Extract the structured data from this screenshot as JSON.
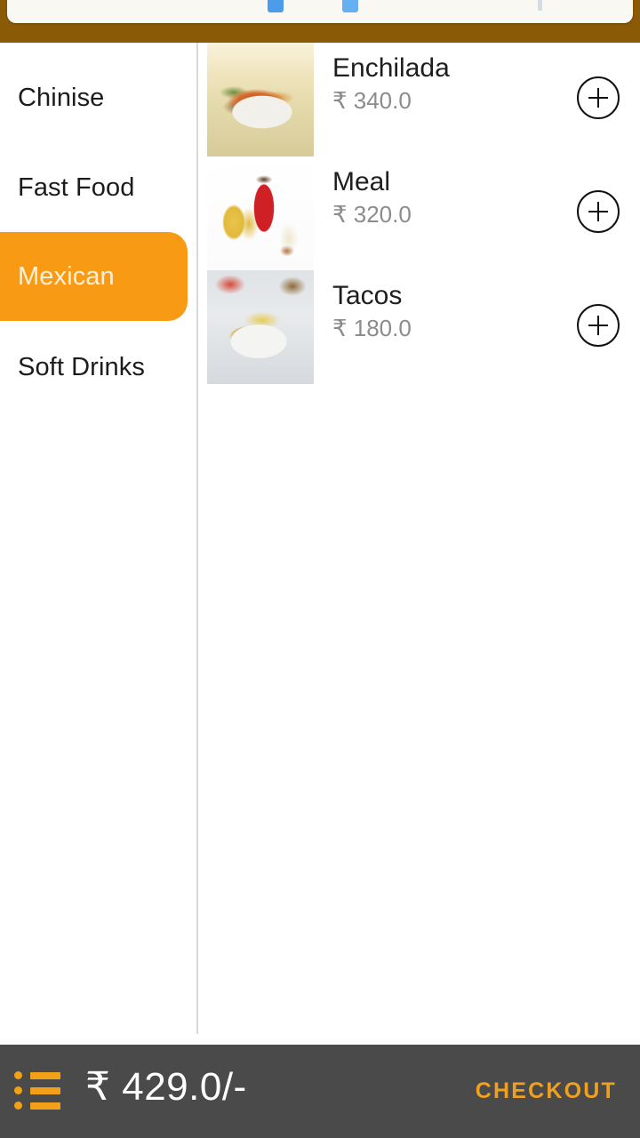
{
  "top_overlay": {
    "icons": [
      "blue-square-icon",
      "blue-square-icon",
      "scrollbar-handle-icon"
    ]
  },
  "sidebar": {
    "items": [
      {
        "label": "Chinise",
        "selected": false
      },
      {
        "label": "Fast Food",
        "selected": false
      },
      {
        "label": "Mexican",
        "selected": true
      },
      {
        "label": "Soft Drinks",
        "selected": false
      }
    ]
  },
  "food_list": {
    "items": [
      {
        "name": "Enchilada",
        "price": "₹ 340.0",
        "add_icon": "plus-circle-icon",
        "thumb": "enchilada-photo"
      },
      {
        "name": "Meal",
        "price": "₹ 320.0",
        "add_icon": "plus-circle-icon",
        "thumb": "meal-photo"
      },
      {
        "name": "Tacos",
        "price": "₹ 180.0",
        "add_icon": "plus-circle-icon",
        "thumb": "tacos-photo"
      }
    ]
  },
  "bottom_bar": {
    "cart_icon": "list-icon",
    "total": "₹ 429.0/-",
    "checkout_label": "CHECKOUT"
  },
  "colors": {
    "accent_orange": "#f99a14",
    "brand_brown": "#8a5a06",
    "bottom_bar_bg": "#4a4a4a",
    "checkout_orange": "#f0a020",
    "price_gray": "#8c8c8c",
    "dialog_cream": "#faf8f3"
  }
}
